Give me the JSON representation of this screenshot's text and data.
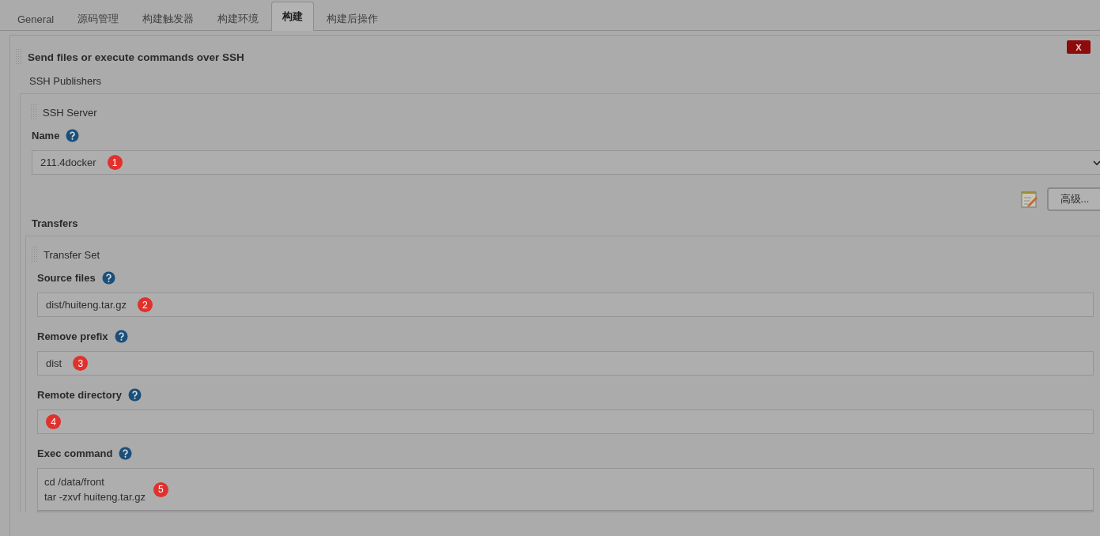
{
  "tabs": [
    {
      "label": "General",
      "selected": false
    },
    {
      "label": "源码管理",
      "selected": false
    },
    {
      "label": "构建触发器",
      "selected": false
    },
    {
      "label": "构建环境",
      "selected": false
    },
    {
      "label": "构建",
      "selected": true
    },
    {
      "label": "构建后操作",
      "selected": false
    }
  ],
  "section": {
    "title": "Send files or execute commands over SSH",
    "close_label": "X",
    "subtitle": "SSH Publishers",
    "server": {
      "title": "SSH Server",
      "name_label": "Name",
      "name_value": "211.4docker",
      "name_marker": "1",
      "advanced_button": "高级...",
      "transfers_label": "Transfers",
      "transfer_set": {
        "title": "Transfer Set",
        "fields": [
          {
            "kind": "input",
            "label": "Source files",
            "value": "dist/huiteng.tar.gz",
            "marker": "2"
          },
          {
            "kind": "input",
            "label": "Remove prefix",
            "value": "dist",
            "marker": "3"
          },
          {
            "kind": "input",
            "label": "Remote directory",
            "marker": "4"
          },
          {
            "kind": "textarea",
            "label": "Exec command",
            "value": "cd /data/front\ntar -zxvf huiteng.tar.gz",
            "marker": "5"
          }
        ]
      }
    }
  }
}
